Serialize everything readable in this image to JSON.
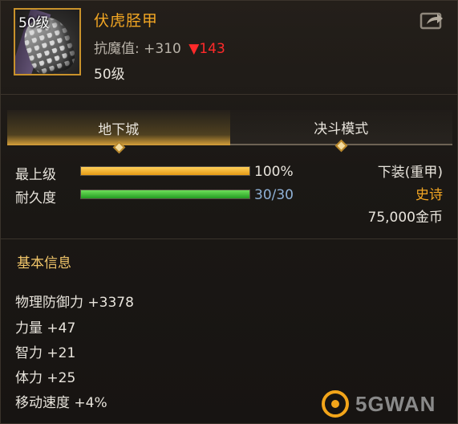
{
  "item": {
    "icon": "scale-greaves-icon",
    "level_badge": "50级",
    "name": "伏虎胫甲",
    "resist_label": "抗魔值:",
    "resist_value": "+310",
    "resist_delta": "▼143",
    "level_text": "50级"
  },
  "header": {
    "share_icon": "share-arrow-icon"
  },
  "tabs": [
    {
      "label": "地下城",
      "active": true
    },
    {
      "label": "决斗模式",
      "active": false
    }
  ],
  "stats": {
    "upgrade_label": "最上级",
    "upgrade_value": "100%",
    "upgrade_fraction": 1.0,
    "durability_label": "耐久度",
    "durability_value": "30/30",
    "durability_fraction": 1.0
  },
  "info": {
    "slot": "下装(重甲)",
    "rarity": "史诗",
    "price": "75,000金币"
  },
  "basic": {
    "title": "基本信息",
    "attributes": [
      "物理防御力 +3378",
      "力量 +47",
      "智力 +21",
      "体力 +25",
      "移动速度 +4%"
    ]
  },
  "watermark": {
    "text": "5GWAN"
  },
  "colors": {
    "name": "#f2a623",
    "rarity": "#f2a623",
    "delta_down": "#ff2a2a",
    "upgrade_bar": "#f2b21c",
    "durability_bar": "#3fc43a",
    "durability_value": "#8fb1d6"
  }
}
